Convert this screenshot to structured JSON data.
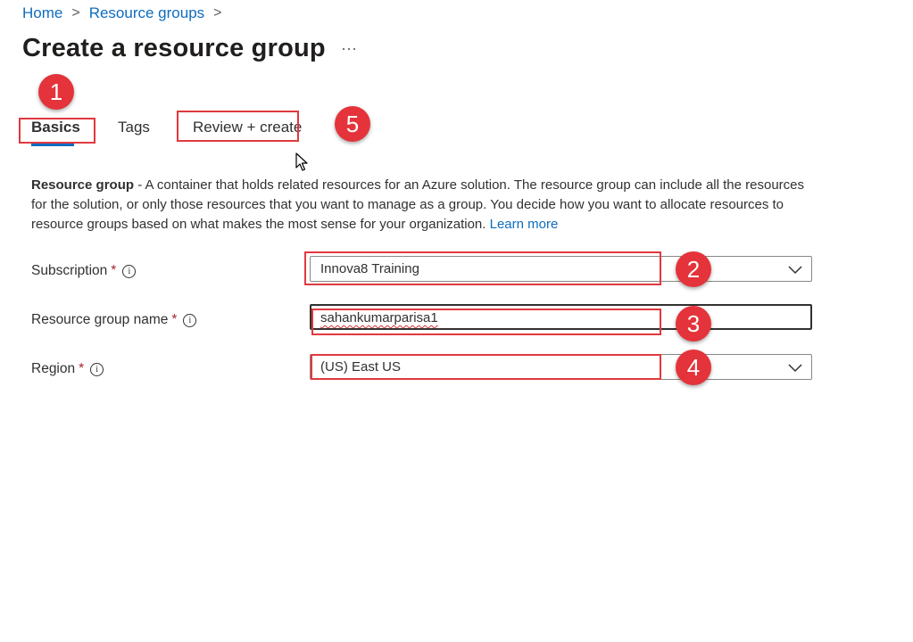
{
  "breadcrumb": {
    "home": "Home",
    "resource_groups": "Resource groups",
    "separator": ">"
  },
  "page": {
    "title": "Create a resource group",
    "more": "···"
  },
  "tabs": [
    {
      "label": "Basics",
      "selected": true
    },
    {
      "label": "Tags",
      "selected": false
    },
    {
      "label": "Review + create",
      "selected": false
    }
  ],
  "description": {
    "bold": "Resource group",
    "text": " - A container that holds related resources for an Azure solution. The resource group can include all the resources for the solution, or only those resources that you want to manage as a group. You decide how you want to allocate resources to resource groups based on what makes the most sense for your organization.",
    "link": "Learn more"
  },
  "form": {
    "subscription": {
      "label": "Subscription",
      "required": "*",
      "value": "Innova8 Training"
    },
    "resource_group_name": {
      "label": "Resource group name",
      "required": "*",
      "value": "sahankumarparisa1"
    },
    "region": {
      "label": "Region",
      "required": "*",
      "value": "(US) East US"
    }
  },
  "info_glyph": "i",
  "annotations": {
    "step1": "1",
    "step2": "2",
    "step3": "3",
    "step4": "4",
    "step5": "5"
  },
  "colors": {
    "accent": "#0f6cbd",
    "annotation_red": "#e4333a",
    "required_red": "#a4262c"
  }
}
